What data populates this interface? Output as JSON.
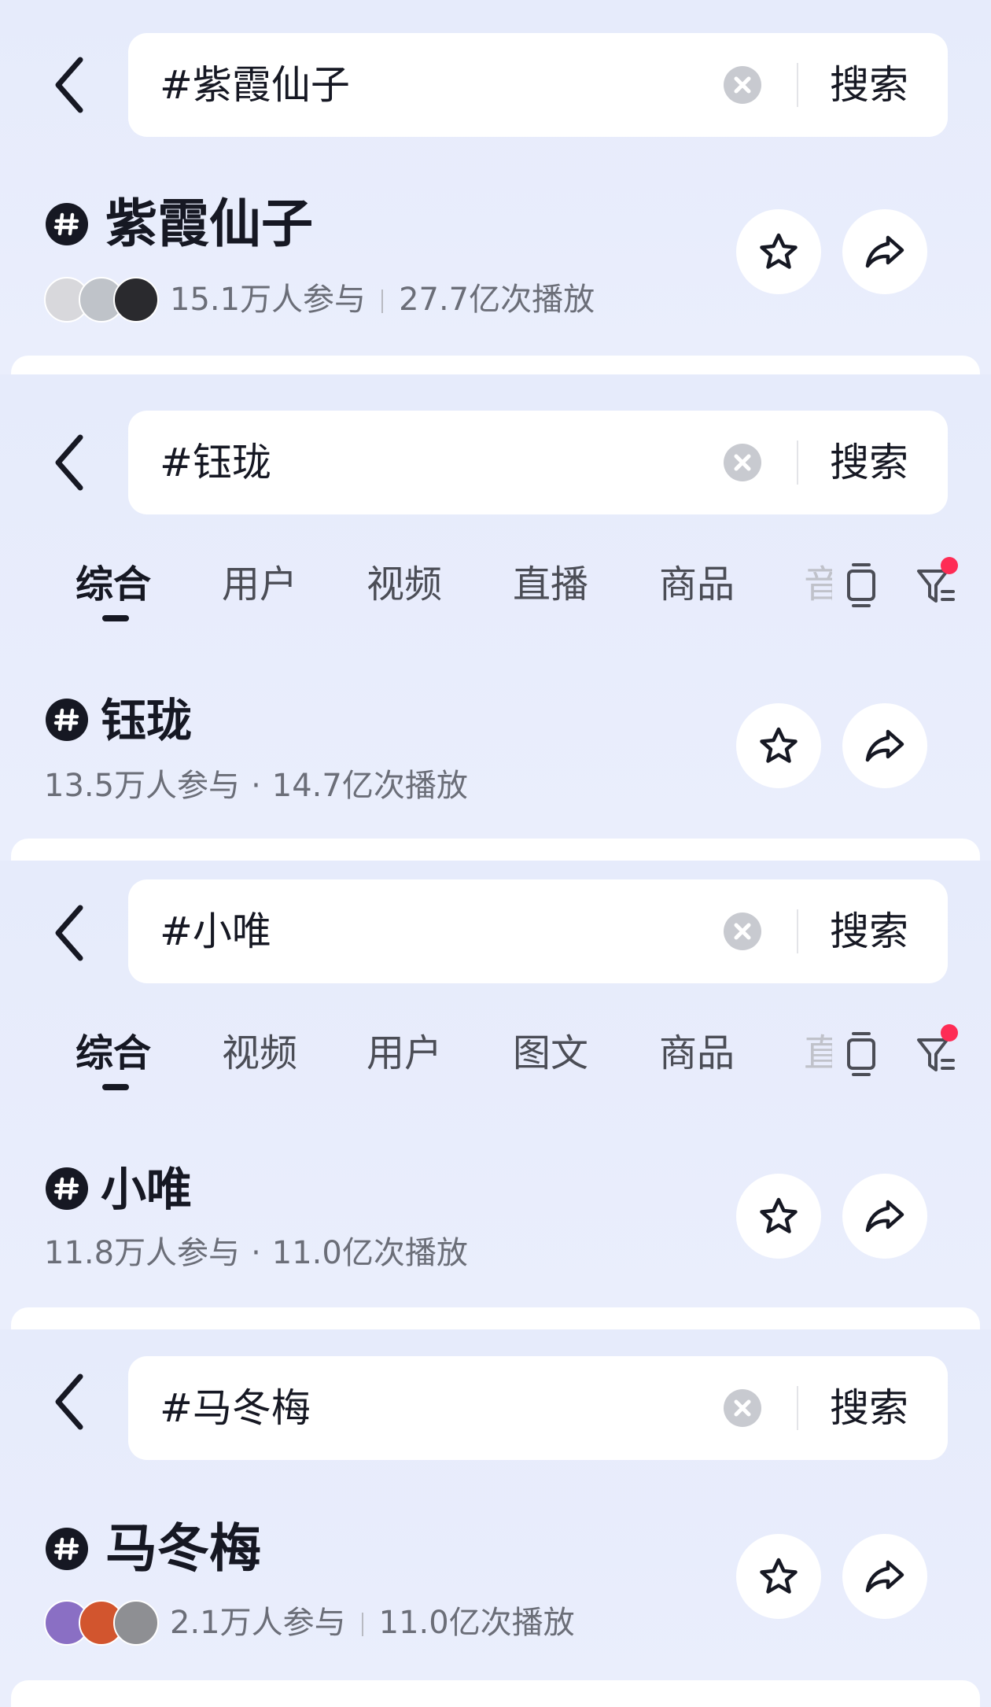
{
  "search_button_label": "搜索",
  "panels": [
    {
      "query": "#紫霞仙子",
      "topic": "紫霞仙子",
      "participants": "15.1万人参与",
      "plays": "27.7亿次播放",
      "separator": "|",
      "avatars": [
        "#d8d8dc",
        "#bfc3c9",
        "#2a2a2e"
      ]
    },
    {
      "query": "#钰珑",
      "tabs": [
        "综合",
        "用户",
        "视频",
        "直播",
        "商品"
      ],
      "faded_tab": "音",
      "topic": "钰珑",
      "participants": "13.5万人参与",
      "plays": "14.7亿次播放",
      "separator": "·"
    },
    {
      "query": "#小唯",
      "tabs": [
        "综合",
        "视频",
        "用户",
        "图文",
        "商品"
      ],
      "faded_tab": "直",
      "topic": "小唯",
      "participants": "11.8万人参与",
      "plays": "11.0亿次播放",
      "separator": "·"
    },
    {
      "query": "#马冬梅",
      "topic": "马冬梅",
      "participants": "2.1万人参与",
      "plays": "11.0亿次播放",
      "separator": "|",
      "avatars": [
        "#8a6fc4",
        "#d2552e",
        "#8e8f93"
      ]
    }
  ],
  "colors": {
    "background": "#e8edfb",
    "text_primary": "#161823",
    "text_secondary": "#6b6e78",
    "accent_red": "#fe2c55"
  },
  "icons": [
    "back-arrow-icon",
    "clear-icon",
    "hashtag-icon",
    "star-icon",
    "share-icon",
    "tablet-icon",
    "filter-icon"
  ]
}
